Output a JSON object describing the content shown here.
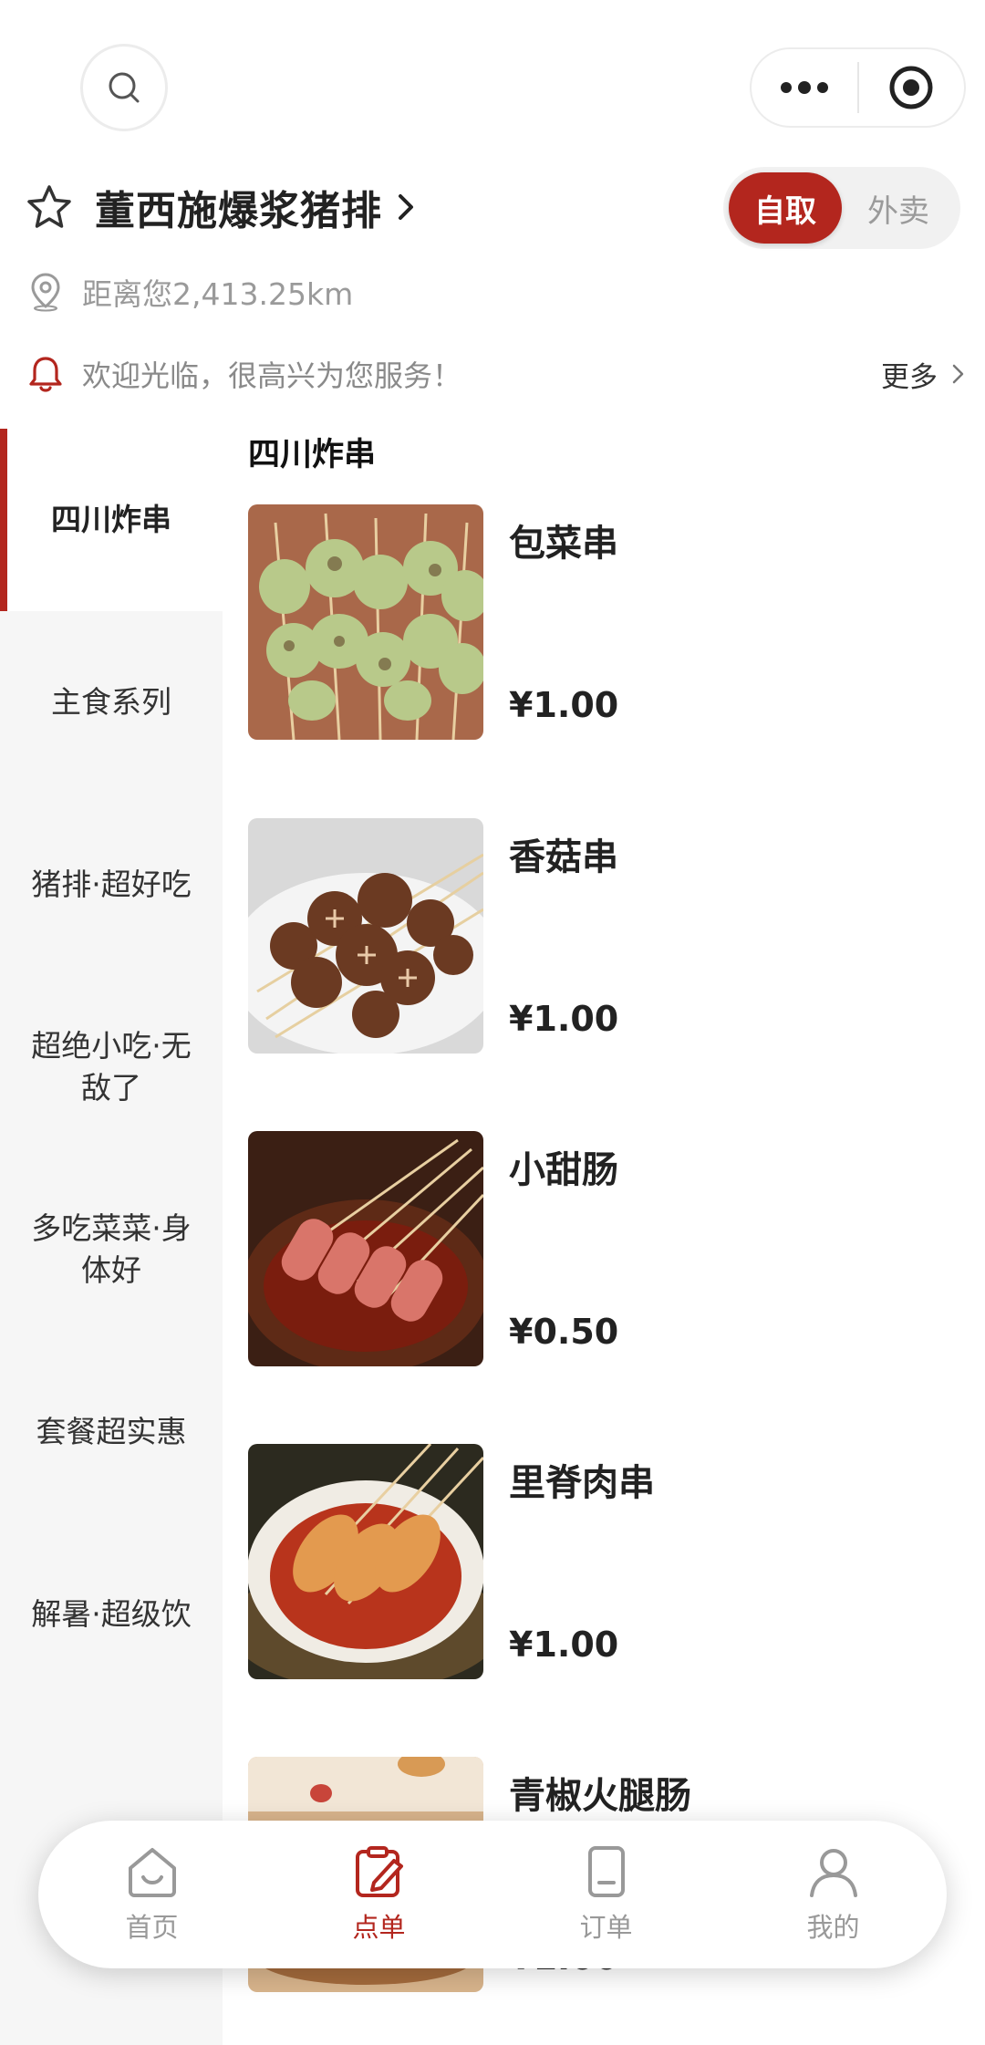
{
  "store": {
    "name": "董西施爆浆猪排",
    "distance": "距离您2,413.25km",
    "notice": "欢迎光临，很高兴为您服务！",
    "more_label": "更多"
  },
  "order_mode": {
    "pickup": "自取",
    "delivery": "外卖",
    "selected": "自取"
  },
  "sidebar": {
    "items": [
      {
        "label": "四川炸串",
        "active": true
      },
      {
        "label": "主食系列"
      },
      {
        "label": "猪排·超好吃"
      },
      {
        "label": "超绝小吃·无敌了"
      },
      {
        "label": "多吃菜菜·身体好"
      },
      {
        "label": "套餐超实惠"
      },
      {
        "label": "解暑·超级饮"
      }
    ]
  },
  "section": {
    "title": "四川炸串"
  },
  "products": [
    {
      "name": "包菜串",
      "price": "¥1.00"
    },
    {
      "name": "香菇串",
      "price": "¥1.00"
    },
    {
      "name": "小甜肠",
      "price": "¥0.50"
    },
    {
      "name": "里脊肉串",
      "price": "¥1.00"
    },
    {
      "name": "青椒火腿肠",
      "price": "¥1.00"
    }
  ],
  "tabbar": {
    "items": [
      {
        "label": "首页",
        "icon": "home-icon"
      },
      {
        "label": "点单",
        "icon": "order-menu-icon",
        "active": true
      },
      {
        "label": "订单",
        "icon": "orders-icon"
      },
      {
        "label": "我的",
        "icon": "profile-icon"
      }
    ]
  },
  "colors": {
    "accent": "#b3261e",
    "muted_text": "#9a9a9a",
    "sidebar_bg": "#f6f6f6"
  }
}
